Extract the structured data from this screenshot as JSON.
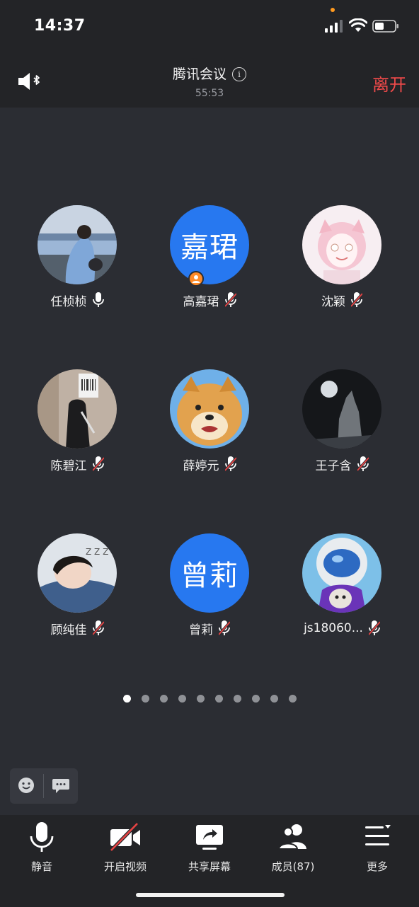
{
  "status_bar": {
    "time": "14:37"
  },
  "header": {
    "title": "腾讯会议",
    "duration": "55:53",
    "leave_label": "离开"
  },
  "participants": [
    {
      "name": "任桢桢",
      "avatar": "photo",
      "mic": "on"
    },
    {
      "name": "高嘉珺",
      "avatar": "嘉珺",
      "mic": "muted",
      "host": true
    },
    {
      "name": "沈颖",
      "avatar": "photo",
      "mic": "muted"
    },
    {
      "name": "陈碧江",
      "avatar": "photo",
      "mic": "muted"
    },
    {
      "name": "薛婷元",
      "avatar": "photo",
      "mic": "muted"
    },
    {
      "name": "王子含",
      "avatar": "photo",
      "mic": "muted"
    },
    {
      "name": "顾纯佳",
      "avatar": "photo",
      "mic": "muted"
    },
    {
      "name": "曾莉",
      "avatar": "曾莉",
      "mic": "muted"
    },
    {
      "name": "js18060...",
      "avatar": "photo",
      "mic": "muted"
    }
  ],
  "pagination": {
    "pages": 10,
    "current": 1
  },
  "toolbar": {
    "mute_label": "静音",
    "video_label": "开启视频",
    "share_label": "共享屏幕",
    "members_label": "成员(87)",
    "more_label": "更多"
  },
  "colors": {
    "accent_blue": "#2778f0",
    "leave_red": "#ef4a4a",
    "host_orange": "#ff8b29"
  }
}
